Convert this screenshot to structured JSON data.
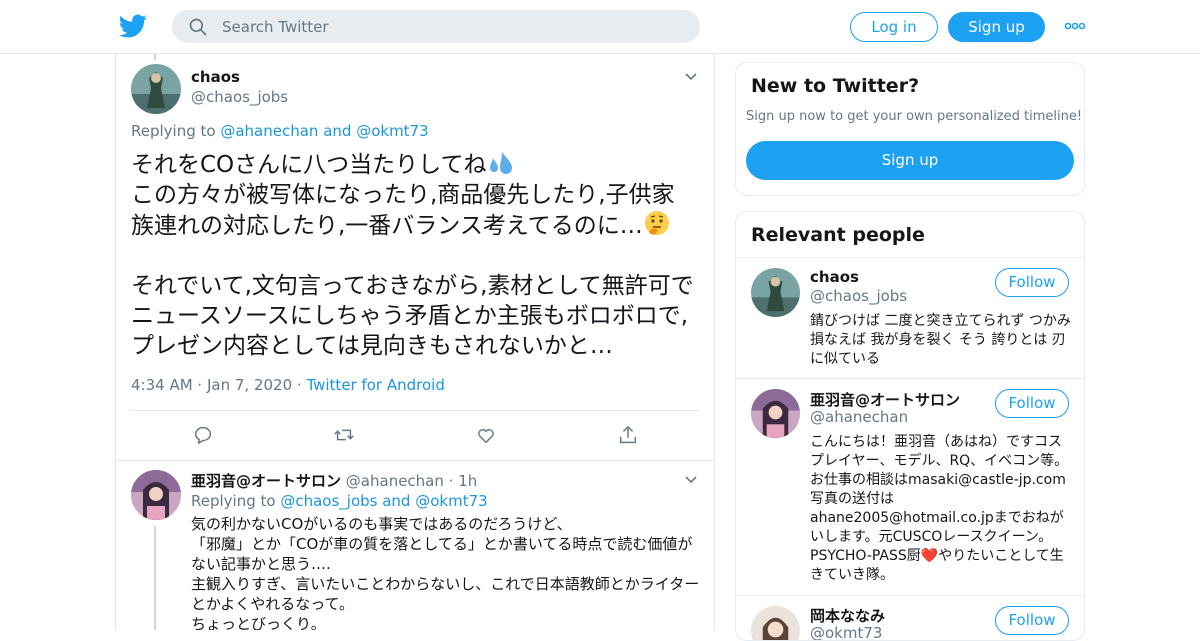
{
  "header": {
    "search_placeholder": "Search Twitter",
    "login_label": "Log in",
    "signup_label": "Sign up",
    "brand_color": "#1da1f2"
  },
  "main_tweet": {
    "name": "chaos",
    "handle": "@chaos_jobs",
    "replying_prefix": "Replying to ",
    "replying_user1": "@ahanechan",
    "replying_and": " and ",
    "replying_user2": "@okmt73",
    "text_line1": "それをCOさんに八つ当たりしてね",
    "text_rest": "この方々が被写体になったり,商品優先したり,子供家族連れの対応したり,一番バランス考えてるのに…",
    "text_para2": "それでいて,文句言っておきながら,素材として無許可でニュースソースにしちゃう矛盾とか主張もボロボロで,プレゼン内容としては見向きもされないかと…",
    "time": "4:34 AM",
    "date": "Jan 7, 2020",
    "source": "Twitter for Android"
  },
  "reply": {
    "name": "亜羽音@オートサロン",
    "handle": "@ahanechan",
    "time": "1h",
    "replying_prefix": "Replying to ",
    "replying_user1": "@chaos_jobs",
    "replying_and": " and ",
    "replying_user2": "@okmt73",
    "text": "気の利かないCOがいるのも事実ではあるのだろうけど、\n「邪魔」とか「COが車の質を落としてる」とか書いてる時点で読む価値がない記事かと思う….\n主観入りすぎ、言いたいことわからないし、これで日本語教師とかライターとかよくやれるなって。\nちょっとびっくり。"
  },
  "sidebar": {
    "new_title": "New to Twitter?",
    "new_sub": "Sign up now to get your own personalized timeline!",
    "new_button": "Sign up",
    "people_title": "Relevant people",
    "people": [
      {
        "name": "chaos",
        "handle": "@chaos_jobs",
        "bio": "錆びつけば 二度と突き立てられず つかみ損なえば 我が身を裂く そう 誇りとは 刃に似ている",
        "follow": "Follow"
      },
      {
        "name": "亜羽音@オートサロン",
        "handle": "@ahanechan",
        "bio": "こんにちは！亜羽音（あはね）ですコスプレイヤー、モデル、RQ、イベコン等。お仕事の相談はmasaki@castle-jp.com 写真の送付はahane2005@hotmail.co.jpまでおねがいします。元CUSCOレースクイーン。PSYCHO-PASS厨❤️やりたいことして生きていき隊。",
        "follow": "Follow"
      },
      {
        "name": "岡本ななみ",
        "handle": "@okmt73",
        "follow": "Follow"
      }
    ]
  }
}
